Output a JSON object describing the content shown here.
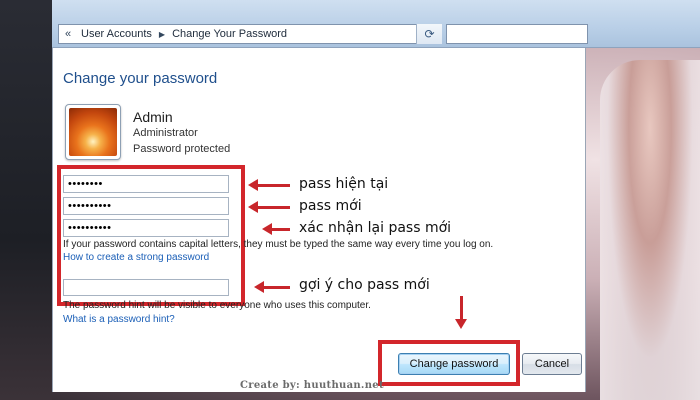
{
  "addressbar": {
    "back_glyph": "«",
    "crumbs": [
      "User Accounts",
      "Change Your Password"
    ]
  },
  "heading": "Change your password",
  "user": {
    "name": "Admin",
    "role": "Administrator",
    "status": "Password protected"
  },
  "fields": {
    "current_password": "••••••••",
    "new_password": "••••••••••",
    "confirm_password": "••••••••••",
    "password_hint": ""
  },
  "notes": {
    "capital_letters": "If your password contains capital letters, they must be typed the same way every time you log on.",
    "strong_password_link": "How to create a strong password",
    "hint_visible": "The password hint will be visible to everyone who uses this computer.",
    "hint_link": "What is a password hint?"
  },
  "annotations": {
    "current": "pass hiện tại",
    "new": "pass mới",
    "confirm": "xác nhận lại pass mới",
    "hint": "gợi ý cho pass mới"
  },
  "buttons": {
    "change_password": "Change password",
    "cancel": "Cancel"
  },
  "credit": "Create by: huuthuan.net",
  "colors": {
    "annotation_red": "#d3262b",
    "heading_blue": "#1f4f8c",
    "link_blue": "#1b5fb7"
  }
}
